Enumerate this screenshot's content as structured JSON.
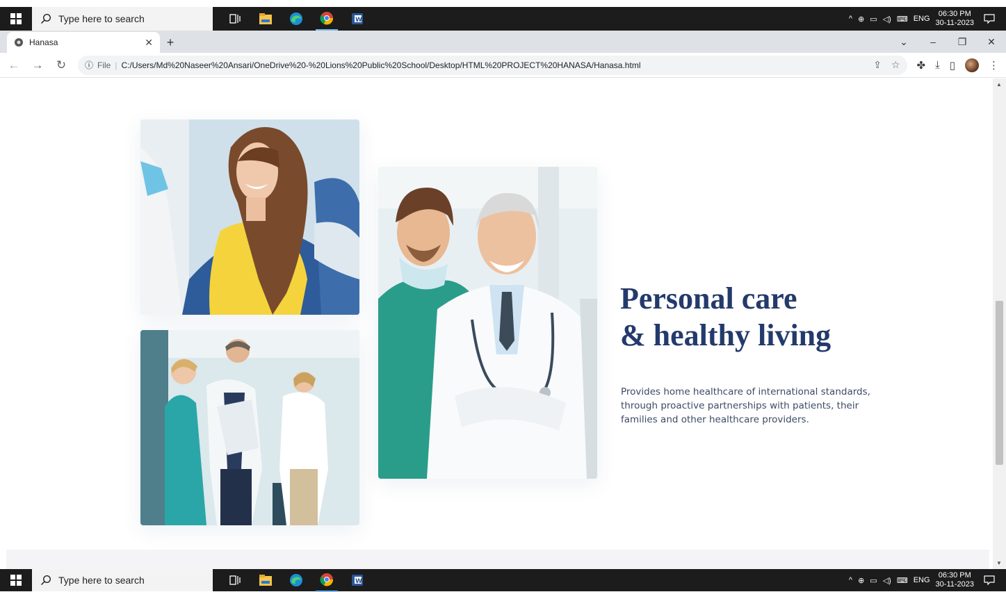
{
  "taskbar": {
    "search_placeholder": "Type here to search",
    "tray_language": "ENG",
    "time": "06:30 PM",
    "date": "30-11-2023"
  },
  "browser": {
    "tab_title": "Hanasa",
    "new_tab_symbol": "+",
    "address_prefix": "File",
    "url": "C:/Users/Md%20Naseer%20Ansari/OneDrive%20-%20Lions%20Public%20School/Desktop/HTML%20PROJECT%20HANASA/Hanasa.html"
  },
  "page": {
    "headline_line1": "Personal care",
    "headline_line2": "& healthy living",
    "description": "Provides home healthcare of international standards, through proactive partnerships with patients, their families and other healthcare providers."
  },
  "icons": {
    "start": "windows-logo-icon",
    "search": "search-icon",
    "task_view": "task-view-icon",
    "explorer": "file-explorer-icon",
    "edge": "edge-icon",
    "chrome": "chrome-icon",
    "word": "word-icon",
    "notifications": "notification-icon"
  },
  "colors": {
    "headline": "#233a6b",
    "body_text": "#3d4a66",
    "taskbar": "#1c1c1c",
    "tabbar": "#dee1e6"
  }
}
